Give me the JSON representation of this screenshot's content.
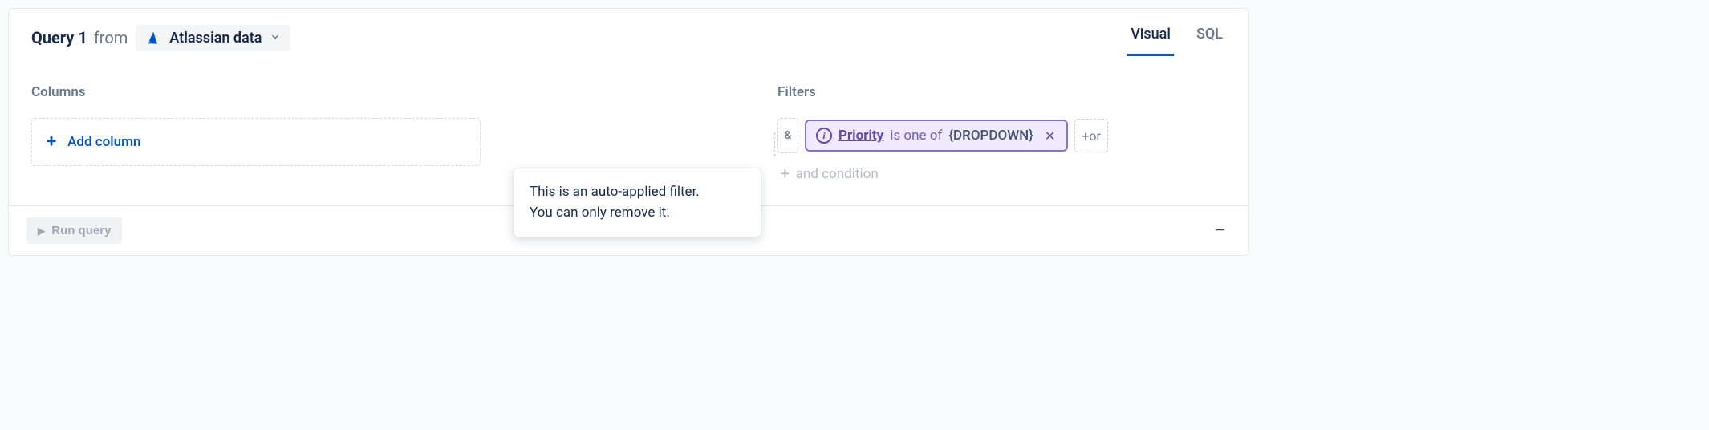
{
  "header": {
    "query_title": "Query 1",
    "from_label": "from",
    "source_label": "Atlassian data"
  },
  "tabs": {
    "visual": "Visual",
    "sql": "SQL"
  },
  "columns": {
    "title": "Columns",
    "add_label": "Add column"
  },
  "filters": {
    "title": "Filters",
    "and_badge": "&",
    "chip_field": "Priority",
    "chip_operator": "is one of",
    "chip_value": "{DROPDOWN}",
    "or_label": "+or",
    "and_cond_label": "and condition"
  },
  "tooltip": {
    "line1": "This is an auto-applied filter.",
    "line2": "You can only remove it."
  },
  "footer": {
    "run_label": "Run query"
  }
}
